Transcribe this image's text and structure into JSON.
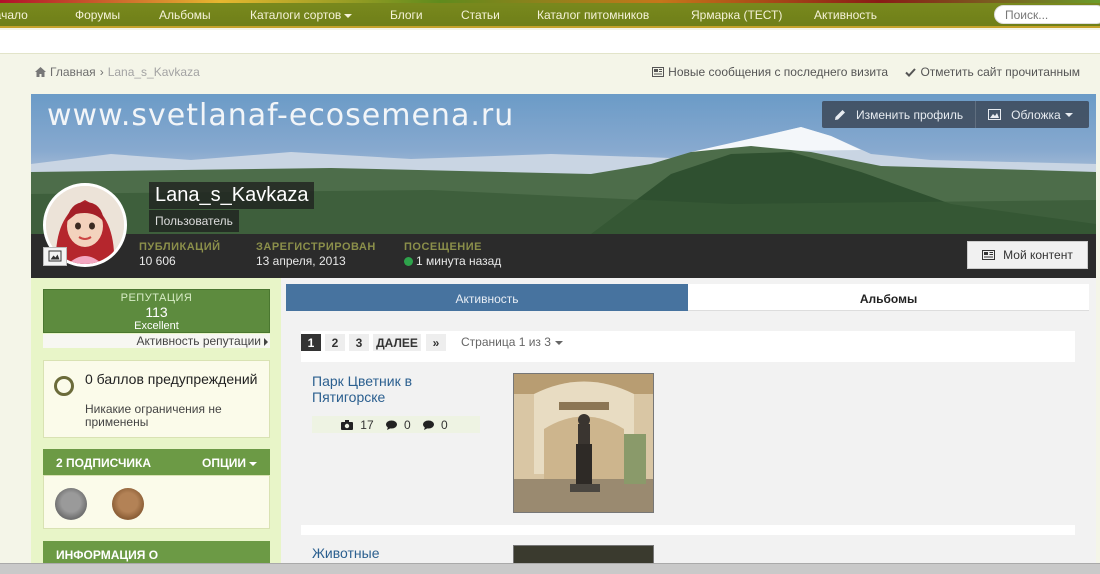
{
  "nav": {
    "items": [
      "Начало",
      "Форумы",
      "Альбомы",
      "Каталоги сортов",
      "Блоги",
      "Статьи",
      "Каталог питомников",
      "Ярмарка (ТЕСТ)",
      "Активность"
    ],
    "search_placeholder": "Поиск..."
  },
  "breadcrumb": {
    "home": "Главная",
    "current": "Lana_s_Kavkaza"
  },
  "crumb_actions": {
    "new_messages": "Новые сообщения с последнего визита",
    "mark_read": "Отметить сайт прочитанным"
  },
  "cover": {
    "site_text": "www.svetlanaf-ecosemena.ru",
    "edit_profile": "Изменить профиль",
    "cover_menu": "Обложка"
  },
  "profile": {
    "name": "Lana_s_Kavkaza",
    "role": "Пользователь"
  },
  "stats": [
    {
      "label": "ПУБЛИКАЦИЙ",
      "value": "10 606"
    },
    {
      "label": "ЗАРЕГИСТРИРОВАН",
      "value": "13 апреля, 2013"
    },
    {
      "label": "ПОСЕЩЕНИЕ",
      "value": "1 минута назад"
    }
  ],
  "my_content": "Мой контент",
  "reputation": {
    "label": "РЕПУТАЦИЯ",
    "value": "113",
    "text": "Excellent",
    "link": "Активность репутации"
  },
  "warnings": {
    "title": "0 баллов предупреждений",
    "subtitle": "Никакие ограничения не применены"
  },
  "subscribers": {
    "title": "2 ПОДПИСЧИКА",
    "options": "ОПЦИИ"
  },
  "info_title": "ИНФОРМАЦИЯ О",
  "tabs": {
    "activity": "Активность",
    "albums": "Альбомы"
  },
  "pagination": {
    "pages": [
      "1",
      "2",
      "3"
    ],
    "next": "ДАЛЕЕ",
    "last": "»",
    "info": "Страница 1 из 3"
  },
  "albums": [
    {
      "title": "Парк Цветник в Пятигорске",
      "images": "17",
      "comments": "0",
      "replies": "0"
    },
    {
      "title": "Животные"
    }
  ],
  "colors": {
    "nav_bg": "#7a8a1e",
    "accent_green": "#6c9a45",
    "tab_blue": "#47739f",
    "online": "#2ea34b"
  }
}
